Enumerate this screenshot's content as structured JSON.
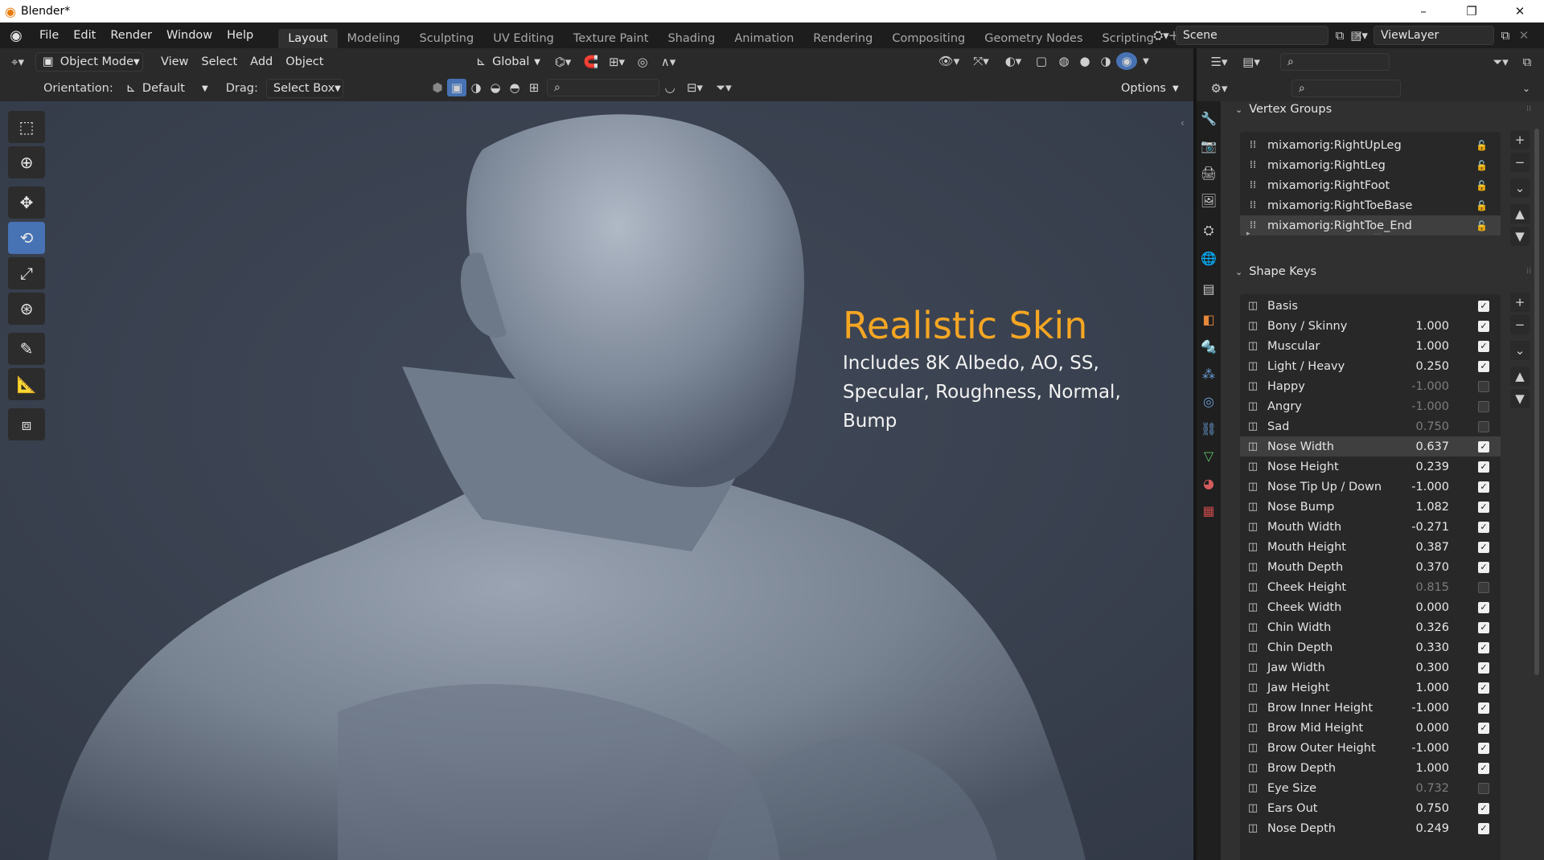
{
  "window": {
    "title": "Blender*",
    "minimize": "–",
    "maximize": "❐",
    "close": "✕"
  },
  "menu": [
    "File",
    "Edit",
    "Render",
    "Window",
    "Help"
  ],
  "workspaces": [
    {
      "label": "Layout",
      "active": true
    },
    {
      "label": "Modeling"
    },
    {
      "label": "Sculpting"
    },
    {
      "label": "UV Editing"
    },
    {
      "label": "Texture Paint"
    },
    {
      "label": "Shading"
    },
    {
      "label": "Animation"
    },
    {
      "label": "Rendering"
    },
    {
      "label": "Compositing"
    },
    {
      "label": "Geometry Nodes"
    },
    {
      "label": "Scripting"
    }
  ],
  "scene": {
    "label": "Scene",
    "view_layer": "ViewLayer",
    "add_tab": "+"
  },
  "viewport_header": {
    "mode": "Object Mode",
    "menus": [
      "View",
      "Select",
      "Add",
      "Object"
    ],
    "transform_orientation": "Global"
  },
  "tool_settings": {
    "orientation_label": "Orientation:",
    "orientation_value": "Default",
    "drag_label": "Drag:",
    "drag_value": "Select Box",
    "options": "Options"
  },
  "overlay": {
    "title": "Realistic Skin",
    "subtitle": "Includes 8K Albedo, AO, SS, Specular, Roughness, Normal, Bump",
    "accent_color": "#f5a623"
  },
  "vertex_groups": {
    "title": "Vertex Groups",
    "items": [
      {
        "name": "mixamorig:RightUpLeg"
      },
      {
        "name": "mixamorig:RightLeg"
      },
      {
        "name": "mixamorig:RightFoot"
      },
      {
        "name": "mixamorig:RightToeBase"
      },
      {
        "name": "mixamorig:RightToe_End",
        "selected": true
      }
    ]
  },
  "shape_keys": {
    "title": "Shape Keys",
    "items": [
      {
        "name": "Basis",
        "value": "",
        "checked": true
      },
      {
        "name": "Bony / Skinny",
        "value": "1.000",
        "checked": true
      },
      {
        "name": "Muscular",
        "value": "1.000",
        "checked": true
      },
      {
        "name": "Light / Heavy",
        "value": "0.250",
        "checked": true
      },
      {
        "name": "Happy",
        "value": "-1.000",
        "checked": false
      },
      {
        "name": "Angry",
        "value": "-1.000",
        "checked": false
      },
      {
        "name": "Sad",
        "value": "0.750",
        "checked": false
      },
      {
        "name": "Nose Width",
        "value": "0.637",
        "checked": true,
        "selected": true
      },
      {
        "name": "Nose Height",
        "value": "0.239",
        "checked": true
      },
      {
        "name": "Nose Tip Up / Down",
        "value": "-1.000",
        "checked": true
      },
      {
        "name": "Nose Bump",
        "value": "1.082",
        "checked": true
      },
      {
        "name": "Mouth Width",
        "value": "-0.271",
        "checked": true
      },
      {
        "name": "Mouth Height",
        "value": "0.387",
        "checked": true
      },
      {
        "name": "Mouth Depth",
        "value": "0.370",
        "checked": true
      },
      {
        "name": "Cheek Height",
        "value": "0.815",
        "checked": false
      },
      {
        "name": "Cheek Width",
        "value": "0.000",
        "checked": true
      },
      {
        "name": "Chin Width",
        "value": "0.326",
        "checked": true
      },
      {
        "name": "Chin Depth",
        "value": "0.330",
        "checked": true
      },
      {
        "name": "Jaw Width",
        "value": "0.300",
        "checked": true
      },
      {
        "name": "Jaw Height",
        "value": "1.000",
        "checked": true
      },
      {
        "name": "Brow Inner Height",
        "value": "-1.000",
        "checked": true
      },
      {
        "name": "Brow Mid Height",
        "value": "0.000",
        "checked": true
      },
      {
        "name": "Brow Outer Height",
        "value": "-1.000",
        "checked": true
      },
      {
        "name": "Brow Depth",
        "value": "1.000",
        "checked": true
      },
      {
        "name": "Eye Size",
        "value": "0.732",
        "checked": false
      },
      {
        "name": "Ears Out",
        "value": "0.750",
        "checked": true
      },
      {
        "name": "Nose Depth",
        "value": "0.249",
        "checked": true
      }
    ]
  },
  "tools": [
    "select-box-icon",
    "cursor-icon",
    "move-icon",
    "rotate-icon",
    "scale-icon",
    "transform-icon",
    "annotate-icon",
    "measure-icon",
    "add-cube-icon"
  ],
  "property_tabs": [
    "tool-icon",
    "render-icon",
    "output-icon",
    "view-layer-icon",
    "scene-icon",
    "world-icon",
    "collection-icon",
    "object-icon",
    "modifier-icon",
    "particles-icon",
    "physics-icon",
    "constraints-icon",
    "data-icon",
    "material-icon",
    "texture-icon"
  ]
}
